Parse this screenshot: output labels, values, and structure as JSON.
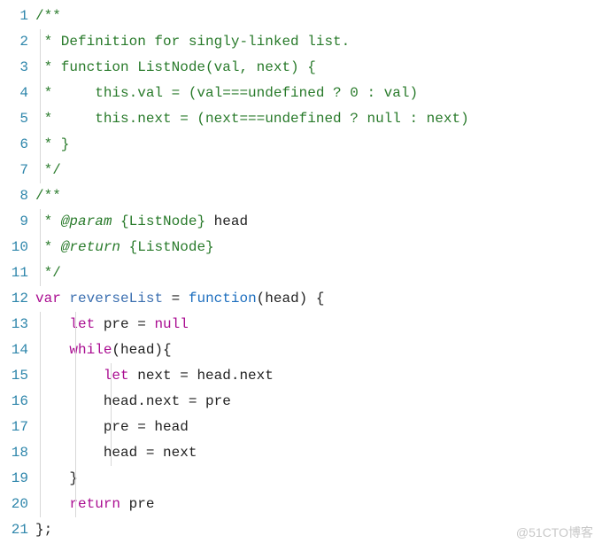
{
  "watermark": "@51CTO博客",
  "lines": [
    {
      "n": 1,
      "guides": [],
      "tokens": [
        {
          "t": "/**",
          "c": "tok-comment"
        }
      ]
    },
    {
      "n": 2,
      "guides": [
        "g1"
      ],
      "tokens": [
        {
          "t": " * Definition for singly-linked list.",
          "c": "tok-comment"
        }
      ]
    },
    {
      "n": 3,
      "guides": [
        "g1"
      ],
      "tokens": [
        {
          "t": " * function ListNode(val, next) {",
          "c": "tok-comment"
        }
      ]
    },
    {
      "n": 4,
      "guides": [
        "g1"
      ],
      "tokens": [
        {
          "t": " *     this.val = (val===undefined ? 0 : val)",
          "c": "tok-comment"
        }
      ]
    },
    {
      "n": 5,
      "guides": [
        "g1"
      ],
      "tokens": [
        {
          "t": " *     this.next = (next===undefined ? null : next)",
          "c": "tok-comment"
        }
      ]
    },
    {
      "n": 6,
      "guides": [
        "g1"
      ],
      "tokens": [
        {
          "t": " * }",
          "c": "tok-comment"
        }
      ]
    },
    {
      "n": 7,
      "guides": [
        "g1"
      ],
      "tokens": [
        {
          "t": " */",
          "c": "tok-comment"
        }
      ]
    },
    {
      "n": 8,
      "guides": [],
      "tokens": [
        {
          "t": "/**",
          "c": "tok-comment"
        }
      ]
    },
    {
      "n": 9,
      "guides": [
        "g1"
      ],
      "tokens": [
        {
          "t": " * ",
          "c": "tok-docstar"
        },
        {
          "t": "@param",
          "c": "tok-dockey"
        },
        {
          "t": " ",
          "c": "tok-docstar"
        },
        {
          "t": "{ListNode}",
          "c": "tok-doctype"
        },
        {
          "t": " head",
          "c": "tok-ident"
        }
      ]
    },
    {
      "n": 10,
      "guides": [
        "g1"
      ],
      "tokens": [
        {
          "t": " * ",
          "c": "tok-docstar"
        },
        {
          "t": "@return",
          "c": "tok-dockey"
        },
        {
          "t": " ",
          "c": "tok-docstar"
        },
        {
          "t": "{ListNode}",
          "c": "tok-doctype"
        }
      ]
    },
    {
      "n": 11,
      "guides": [
        "g1"
      ],
      "tokens": [
        {
          "t": " */",
          "c": "tok-comment"
        }
      ]
    },
    {
      "n": 12,
      "guides": [],
      "tokens": [
        {
          "t": "var",
          "c": "tok-keyword"
        },
        {
          "t": " ",
          "c": "tok-punct"
        },
        {
          "t": "reverseList",
          "c": "tok-call"
        },
        {
          "t": " = ",
          "c": "tok-punct"
        },
        {
          "t": "function",
          "c": "tok-funcdef"
        },
        {
          "t": "(head) {",
          "c": "tok-punct"
        }
      ]
    },
    {
      "n": 13,
      "guides": [
        "g1",
        "g2"
      ],
      "tokens": [
        {
          "t": "    ",
          "c": "tok-punct"
        },
        {
          "t": "let",
          "c": "tok-keyword"
        },
        {
          "t": " pre = ",
          "c": "tok-punct"
        },
        {
          "t": "null",
          "c": "tok-null"
        }
      ]
    },
    {
      "n": 14,
      "guides": [
        "g1",
        "g2"
      ],
      "tokens": [
        {
          "t": "    ",
          "c": "tok-punct"
        },
        {
          "t": "while",
          "c": "tok-keyword"
        },
        {
          "t": "(head){",
          "c": "tok-punct"
        }
      ]
    },
    {
      "n": 15,
      "guides": [
        "g1",
        "g2",
        "g3"
      ],
      "tokens": [
        {
          "t": "        ",
          "c": "tok-punct"
        },
        {
          "t": "let",
          "c": "tok-keyword"
        },
        {
          "t": " next = head.next",
          "c": "tok-punct"
        }
      ]
    },
    {
      "n": 16,
      "guides": [
        "g1",
        "g2",
        "g3"
      ],
      "tokens": [
        {
          "t": "        head.next = pre",
          "c": "tok-punct"
        }
      ]
    },
    {
      "n": 17,
      "guides": [
        "g1",
        "g2",
        "g3"
      ],
      "tokens": [
        {
          "t": "        pre = head",
          "c": "tok-punct"
        }
      ]
    },
    {
      "n": 18,
      "guides": [
        "g1",
        "g2",
        "g3"
      ],
      "tokens": [
        {
          "t": "        head = next",
          "c": "tok-punct"
        }
      ]
    },
    {
      "n": 19,
      "guides": [
        "g1",
        "g2"
      ],
      "tokens": [
        {
          "t": "    }",
          "c": "tok-punct"
        }
      ]
    },
    {
      "n": 20,
      "guides": [
        "g1",
        "g2"
      ],
      "tokens": [
        {
          "t": "    ",
          "c": "tok-punct"
        },
        {
          "t": "return",
          "c": "tok-keyword"
        },
        {
          "t": " pre",
          "c": "tok-punct"
        }
      ]
    },
    {
      "n": 21,
      "guides": [],
      "tokens": [
        {
          "t": "};",
          "c": "tok-punct"
        }
      ]
    }
  ]
}
